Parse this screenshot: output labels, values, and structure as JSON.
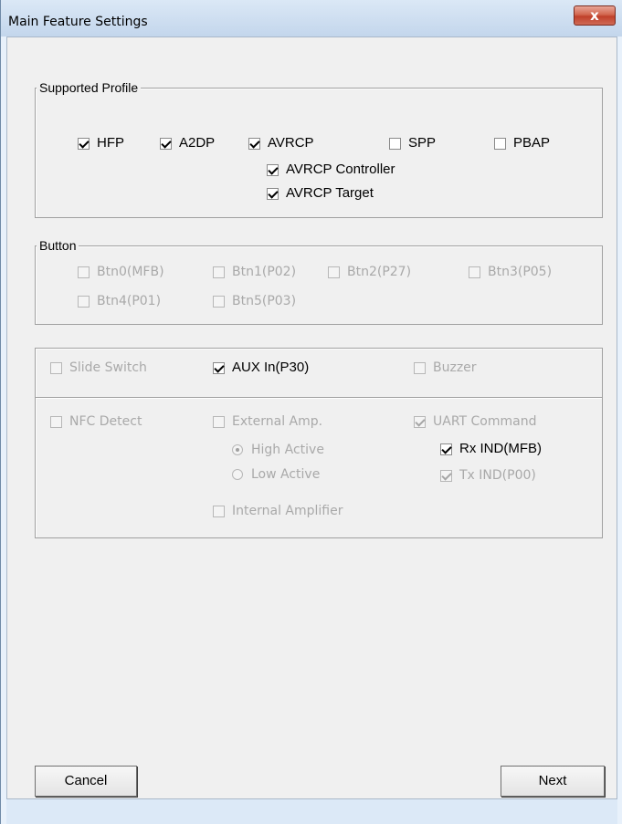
{
  "window": {
    "title": "Main Feature Settings",
    "close_label": "x"
  },
  "supported_profile": {
    "legend": "Supported Profile",
    "items": [
      {
        "label": "HFP",
        "checked": true
      },
      {
        "label": "A2DP",
        "checked": true
      },
      {
        "label": "AVRCP",
        "checked": true
      },
      {
        "label": "SPP",
        "checked": false
      },
      {
        "label": "PBAP",
        "checked": false
      },
      {
        "label": "AVRCP Controller",
        "checked": true
      },
      {
        "label": "AVRCP Target",
        "checked": true
      }
    ]
  },
  "button_group": {
    "legend": "Button",
    "items": [
      {
        "label": "Btn0(MFB)",
        "checked": false,
        "enabled": false
      },
      {
        "label": "Btn1(P02)",
        "checked": false,
        "enabled": false
      },
      {
        "label": "Btn2(P27)",
        "checked": false,
        "enabled": false
      },
      {
        "label": "Btn3(P05)",
        "checked": false,
        "enabled": false
      },
      {
        "label": "Btn4(P01)",
        "checked": false,
        "enabled": false
      },
      {
        "label": "Btn5(P03)",
        "checked": false,
        "enabled": false
      }
    ]
  },
  "features": {
    "slide_switch": {
      "label": "Slide Switch",
      "checked": false,
      "enabled": false
    },
    "aux_in": {
      "label": "AUX In(P30)",
      "checked": true,
      "enabled": true
    },
    "buzzer": {
      "label": "Buzzer",
      "checked": false,
      "enabled": false
    },
    "nfc_detect": {
      "label": "NFC Detect",
      "checked": false,
      "enabled": false
    },
    "external_amp": {
      "label": "External Amp.",
      "checked": false,
      "enabled": false
    },
    "high_active": {
      "label": "High Active",
      "selected": true,
      "enabled": false
    },
    "low_active": {
      "label": "Low Active",
      "selected": false,
      "enabled": false
    },
    "internal_amp": {
      "label": "Internal Amplifier",
      "checked": false,
      "enabled": false
    },
    "uart_command": {
      "label": "UART Command",
      "checked": true,
      "enabled": false
    },
    "rx_ind": {
      "label": "Rx IND(MFB)",
      "checked": true,
      "enabled": true
    },
    "tx_ind": {
      "label": "Tx IND(P00)",
      "checked": true,
      "enabled": false
    }
  },
  "footer": {
    "cancel_label": "Cancel",
    "next_label": "Next"
  }
}
